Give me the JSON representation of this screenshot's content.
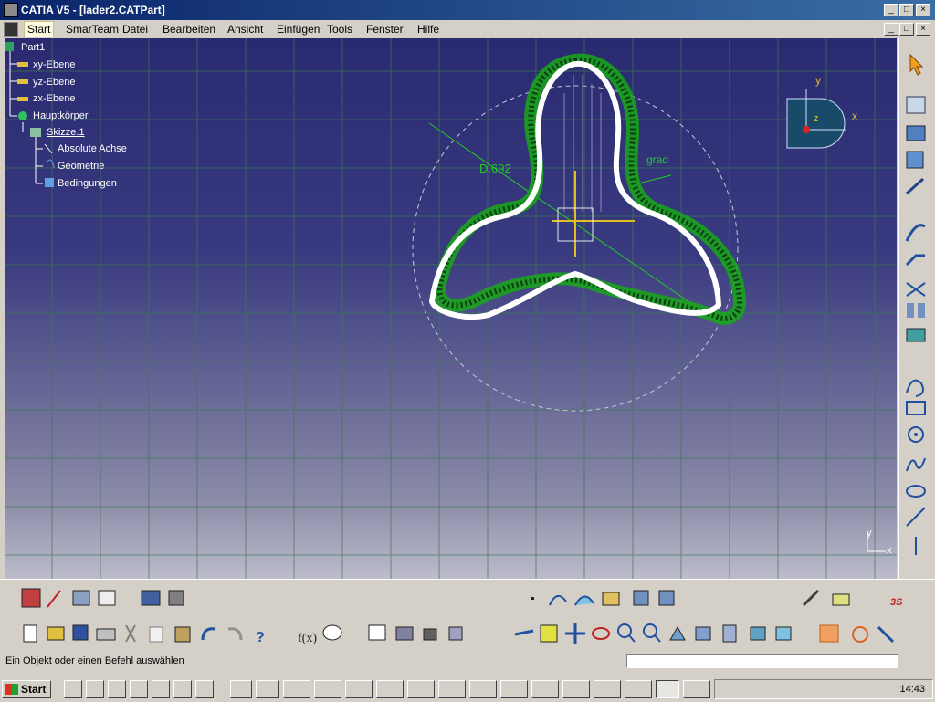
{
  "window": {
    "title": "CATIA V5 - [lader2.CATPart]",
    "buttons": [
      "_",
      "□",
      "×"
    ]
  },
  "menu": {
    "items": [
      "Start",
      "SmarTeam",
      "Datei",
      "Bearbeiten",
      "Ansicht",
      "Einfügen",
      "Tools",
      "Fenster",
      "Hilfe"
    ]
  },
  "tree": {
    "root": "Part1",
    "items": [
      "xy-Ebene",
      "yz-Ebene",
      "zx-Ebene",
      "Hauptkörper",
      "Skizze.1",
      "Absolute Achse",
      "Geometrie",
      "Bedingungen"
    ]
  },
  "viewport": {
    "dimension_label": "D.692",
    "angle_label": "grad",
    "compass": {
      "x": "x",
      "y": "y",
      "z": "z"
    },
    "axis_small": {
      "x": "x",
      "y": "y"
    }
  },
  "status": {
    "message": "Ein Objekt oder einen Befehl auswählen"
  },
  "taskbar": {
    "start": "Start",
    "clock": "14:43"
  },
  "colors": {
    "title_bg": "#0a246a",
    "viewport_top": "#2a2a70",
    "sketch_green": "#22cc22",
    "profile_white": "#ffffff"
  }
}
